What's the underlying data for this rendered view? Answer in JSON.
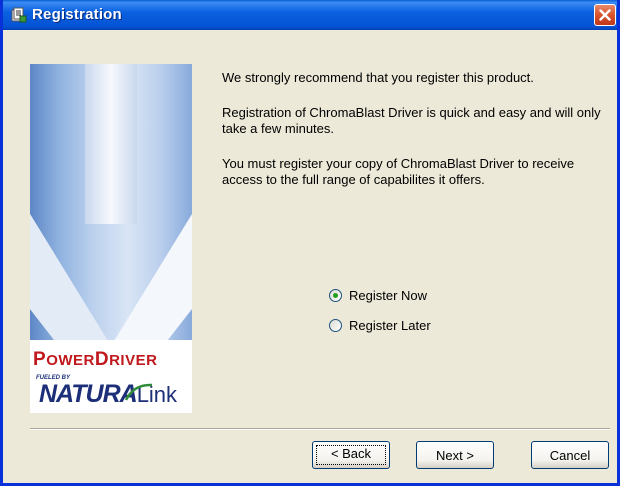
{
  "window": {
    "title": "Registration",
    "icon": "registration-app-icon",
    "close_icon": "close-icon"
  },
  "sidebar_logo": {
    "brand_top_first": "P",
    "brand_top_rest": "OWER",
    "brand_top_first2": "D",
    "brand_top_rest2": "RIVER",
    "tagline": "FUELED BY",
    "brand_bottom": "NATURA",
    "brand_bottom_link": "Link"
  },
  "messages": {
    "line1": "We strongly recommend that you register this product.",
    "line2": "Registration of ChromaBlast Driver is quick and easy and will only take a few minutes.",
    "line3": "You must register your copy of ChromaBlast Driver to receive access to the full range of capabilites it offers."
  },
  "options": {
    "register_now": "Register Now",
    "register_later": "Register Later",
    "selected": "register_now"
  },
  "buttons": {
    "back": "< Back",
    "next": "Next >",
    "cancel": "Cancel"
  },
  "colors": {
    "titlebar": "#0553d6",
    "window_border": "#0831d9",
    "dialog_bg": "#ece9d8",
    "close_button": "#d9532c",
    "brand_red": "#c0181d",
    "brand_blue": "#1c2f78",
    "radio_dot": "#21a121"
  }
}
